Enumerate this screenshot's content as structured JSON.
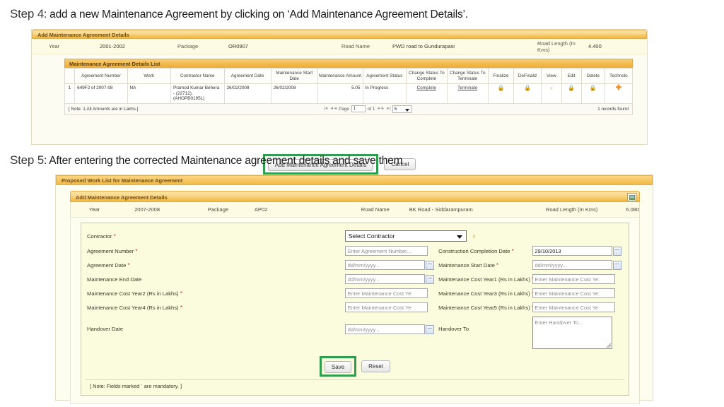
{
  "steps": {
    "step4": {
      "label": "Step 4",
      "text": ": add a new Maintenance Agreement by clicking on ‘Add Maintenance Agreement Details’."
    },
    "step5": {
      "label": "Step 5",
      "text": ": After entering the corrected Maintenance agreement details and save them"
    }
  },
  "shot1": {
    "panel_title": "Add Maintenance Agreement Details",
    "meta": {
      "year_label": "Year",
      "year_value": "2001-2002",
      "package_label": "Package",
      "package_value": "OR0907",
      "road_name_label": "Road Name",
      "road_name_value": "PWD road to Gundurapasi",
      "road_length_label": "Road Length (In Kms)",
      "road_length_value": "4.400"
    },
    "list_title": "Maintenance Agreement Details List",
    "columns": [
      "",
      "Agreement Number",
      "Work",
      "Contractor Name",
      "Agreement Date",
      "Maintenance Start Date",
      "Maintenance Amount",
      "Agreement Status",
      "Change Status To Complete",
      "Change Status To Terminate",
      "Finalize",
      "DeFinaliz",
      "View",
      "Edit",
      "Delete",
      "Technolo"
    ],
    "row": {
      "index": "1",
      "agreement_number": "649F2 of 2007-08",
      "work": "NA",
      "contractor_name": "Pramod Kumar Behera - (22712), (AHOPB0195L)",
      "agreement_date": "26/02/2008",
      "maintenance_start_date": "26/02/2008",
      "maintenance_amount": "5.05",
      "agreement_status": "In Progress",
      "complete_link": "Complete",
      "terminate_link": "Terminate",
      "finalize_icon": "lock-icon",
      "definalize_icon": "lock-icon",
      "view_icon": "magnifier-icon",
      "edit_icon": "lock-icon",
      "delete_icon": "lock-icon",
      "technology_icon": "plus-icon"
    },
    "footer": {
      "note": "[ Note: 1.All Amounts are in Lakhs.]",
      "first_icon": "|◄",
      "prev_icon": "◄◄",
      "page_label": "Page",
      "page_value": "1",
      "of_label": "of 1",
      "next_icon": "►►",
      "last_icon": "►|",
      "page_size": "5",
      "records": "1 records found"
    },
    "buttons": {
      "add": "Add Maintenance Agreement Details",
      "cancel": "Cancel"
    }
  },
  "shot2": {
    "proposed_title": "Proposed Work List for Maintenance Agreement",
    "panel_title": "Add Maintenance Agreement Details",
    "corner_icon": "image-icon",
    "meta": {
      "year_label": "Year",
      "year_value": "2007-2008",
      "package_label": "Package",
      "package_value": "AP02",
      "road_name_label": "Road Name",
      "road_name_value": "BK Road - Siddarampuram",
      "road_length_label": "Road Length (In Kms)",
      "road_length_value": "6.080"
    },
    "fields": {
      "contractor": {
        "label": "Contractor",
        "required": true,
        "value": "Select Contractor",
        "search_icon": "search-icon"
      },
      "agreement_number": {
        "label": "Agreement Number",
        "required": true,
        "placeholder": "Enter Agreement Number..."
      },
      "construction_completion_date": {
        "label": "Construction Completion Date",
        "required": true,
        "value": "29/10/2013",
        "calendar_icon": "calendar-icon"
      },
      "agreement_date": {
        "label": "Agreement Date",
        "required": true,
        "placeholder": "dd/mm/yyyy...",
        "calendar_icon": "calendar-icon"
      },
      "maintenance_start_date": {
        "label": "Maintenance Start Date",
        "required": true,
        "placeholder": "dd/mm/yyyy...",
        "calendar_icon": "calendar-icon"
      },
      "maintenance_end_date": {
        "label": "Maintenance End Date",
        "required": false,
        "placeholder": "dd/mm/yyyy...",
        "calendar_icon": "calendar-icon"
      },
      "cost_year1": {
        "label": "Maintenance Cost Year1 (Rs in Lakhs)",
        "required": true,
        "placeholder": "Enter Maintenance Cost Ye:"
      },
      "cost_year2": {
        "label": "Maintenance Cost Year2 (Rs in Lakhs)",
        "required": true,
        "placeholder": "Enter Maintenance Cost Ye:"
      },
      "cost_year3": {
        "label": "Maintenance Cost Year3 (Rs in Lakhs)",
        "required": true,
        "placeholder": "Enter Maintenance Cost Ye:"
      },
      "cost_year4": {
        "label": "Maintenance Cost Year4 (Rs in Lakhs)",
        "required": true,
        "placeholder": "Enter Maintenance Cost Ye:"
      },
      "cost_year5": {
        "label": "Maintenance Cost Year5 (Rs in Lakhs)",
        "required": true,
        "placeholder": "Enter Maintenance Cost Ye:"
      },
      "handover_date": {
        "label": "Handover Date",
        "required": false,
        "placeholder": "dd/mm/yyyy...",
        "calendar_icon": "calendar-icon"
      },
      "handover_to": {
        "label": "Handover To",
        "required": false,
        "placeholder": "Enter Handover To..."
      }
    },
    "buttons": {
      "save": "Save",
      "reset": "Reset"
    },
    "footer_note": "[ Note: Fields marked ˈ are mandatory. ]"
  },
  "colors": {
    "panel_header_start": "#fbe3a4",
    "panel_header_end": "#f2b73f",
    "list_header": "#f2b84b",
    "highlight_green": "#2f9e4f",
    "icon_orange": "#e08b1e",
    "required_red": "#cc2a2a",
    "form_card_bg": "#fbfbdd",
    "meta_row_bg": "#fdfbe3"
  }
}
